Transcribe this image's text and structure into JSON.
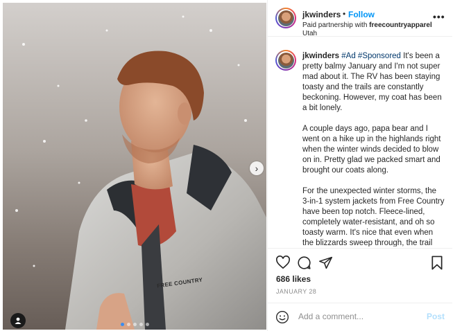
{
  "header": {
    "username": "jkwinders",
    "separator": "•",
    "follow_label": "Follow",
    "partnership_prefix": "Paid partnership with ",
    "partner": "freecountryapparel",
    "location": "Utah",
    "more_icon": "more-horizontal-icon"
  },
  "caption": {
    "username": "jkwinders",
    "hashtags": "#Ad #Sponsored",
    "paragraph1": " It's been a pretty balmy January and I'm not super mad about it. The RV has been staying toasty and the trails are constantly beckoning. However, my coat has been a bit lonely.",
    "paragraph2": "A couple days ago, papa bear and I went on a hike up in the highlands right when the winter winds decided to blow on in. Pretty glad we packed smart and brought our coats along.",
    "paragraph3": "For the unexpected winter storms, the 3-in-1 system jackets from Free Country have been top notch. Fleece-lined, completely water-resistant, and oh so toasty warm. It's nice that even when the blizzards sweep through, the trail still beckons. Visit"
  },
  "media": {
    "jacket_brand": "FREE COUNTRY",
    "next_icon": "chevron-right-icon",
    "tag_icon": "user-tag-icon",
    "slide_count": 5,
    "active_slide": 1
  },
  "stats": {
    "likes": "686 likes",
    "date": "JANUARY 28"
  },
  "comment": {
    "placeholder": "Add a comment...",
    "post_label": "Post"
  },
  "colors": {
    "link_blue": "#0095f6",
    "post_disabled": "#b2dffc",
    "hashtag": "#00376b",
    "muted": "#8e8e8e"
  }
}
